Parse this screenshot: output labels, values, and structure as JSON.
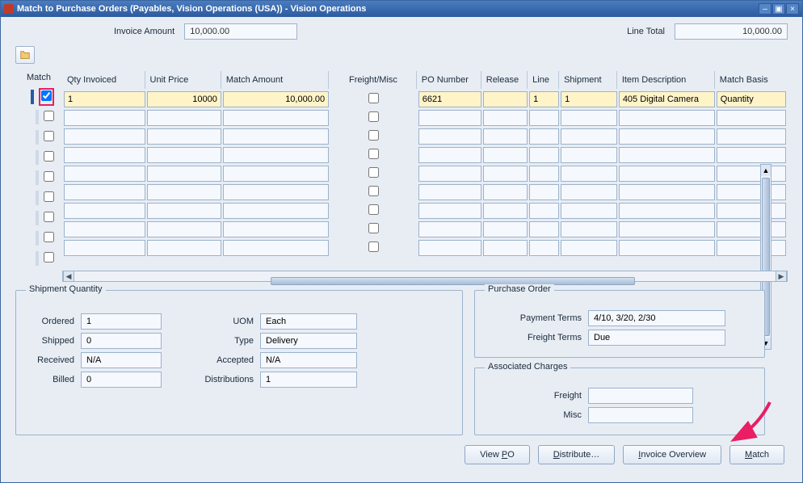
{
  "window": {
    "title": "Match to Purchase Orders (Payables, Vision Operations (USA)) - Vision Operations"
  },
  "top": {
    "invoice_amount_label": "Invoice Amount",
    "invoice_amount": "10,000.00",
    "line_total_label": "Line Total",
    "line_total": "10,000.00"
  },
  "grid": {
    "match_header": "Match",
    "headers": {
      "qty": "Qty Invoiced",
      "price": "Unit Price",
      "amount": "Match Amount",
      "freight": "Freight/Misc",
      "po": "PO Number",
      "release": "Release",
      "line": "Line",
      "shipment": "Shipment",
      "desc": "Item Description",
      "basis": "Match Basis"
    },
    "rows": [
      {
        "match": true,
        "marker": true,
        "qty": "1",
        "price": "10000",
        "amount": "10,000.00",
        "freight": false,
        "po": "6621",
        "release": "",
        "line": "1",
        "shipment": "1",
        "desc": "405 Digital Camera",
        "basis": "Quantity"
      },
      {
        "match": false,
        "marker": false
      },
      {
        "match": false,
        "marker": false
      },
      {
        "match": false,
        "marker": false
      },
      {
        "match": false,
        "marker": false
      },
      {
        "match": false,
        "marker": false
      },
      {
        "match": false,
        "marker": false
      },
      {
        "match": false,
        "marker": false
      },
      {
        "match": false,
        "marker": false
      }
    ]
  },
  "shipment": {
    "legend": "Shipment Quantity",
    "ordered_label": "Ordered",
    "ordered": "1",
    "shipped_label": "Shipped",
    "shipped": "0",
    "received_label": "Received",
    "received": "N/A",
    "billed_label": "Billed",
    "billed": "0",
    "uom_label": "UOM",
    "uom": "Each",
    "type_label": "Type",
    "type": "Delivery",
    "accepted_label": "Accepted",
    "accepted": "N/A",
    "distributions_label": "Distributions",
    "distributions": "1"
  },
  "po": {
    "legend": "Purchase Order",
    "payment_terms_label": "Payment Terms",
    "payment_terms": "4/10, 3/20, 2/30",
    "freight_terms_label": "Freight Terms",
    "freight_terms": "Due"
  },
  "assoc": {
    "legend": "Associated Charges",
    "freight_label": "Freight",
    "freight": "",
    "misc_label": "Misc",
    "misc": ""
  },
  "buttons": {
    "view_po": "View PO",
    "distribute": "Distribute…",
    "overview": "Invoice Overview",
    "match": "Match"
  }
}
